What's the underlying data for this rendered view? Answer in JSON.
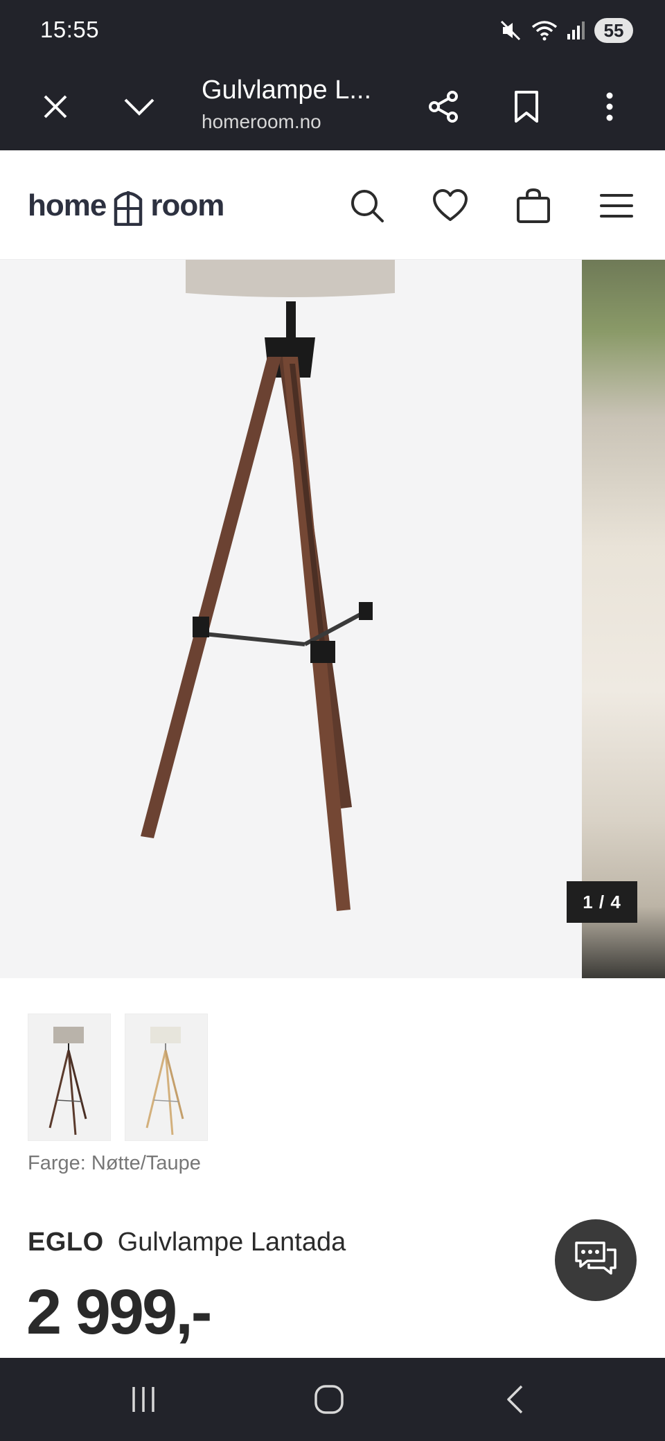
{
  "status_bar": {
    "time": "15:55",
    "battery": "55",
    "icons": [
      "mute-icon",
      "wifi-icon",
      "signal-icon",
      "battery-icon"
    ]
  },
  "browser": {
    "tab_title": "Gulvlampe L...",
    "url": "homeroom.no",
    "icons": [
      "close-icon",
      "chevron-down-icon",
      "share-icon",
      "bookmark-icon",
      "more-icon"
    ]
  },
  "site_header": {
    "logo_left": "home",
    "logo_right": "room",
    "icons": [
      "search-icon",
      "heart-icon",
      "bag-icon",
      "menu-icon"
    ]
  },
  "gallery": {
    "counter": "1 / 4"
  },
  "product": {
    "color_label": "Farge: Nøtte/Taupe",
    "brand": "EGLO",
    "name": "Gulvlampe Lantada",
    "price": "2 999,-",
    "variants": [
      "Nøtte/Taupe",
      "Natur/Hvit"
    ]
  },
  "colors": {
    "browser_bar": "#22232a",
    "logo": "#2d3140",
    "lamp_wood": "#6b4232",
    "lamp_shade": "#cdc7bf"
  }
}
